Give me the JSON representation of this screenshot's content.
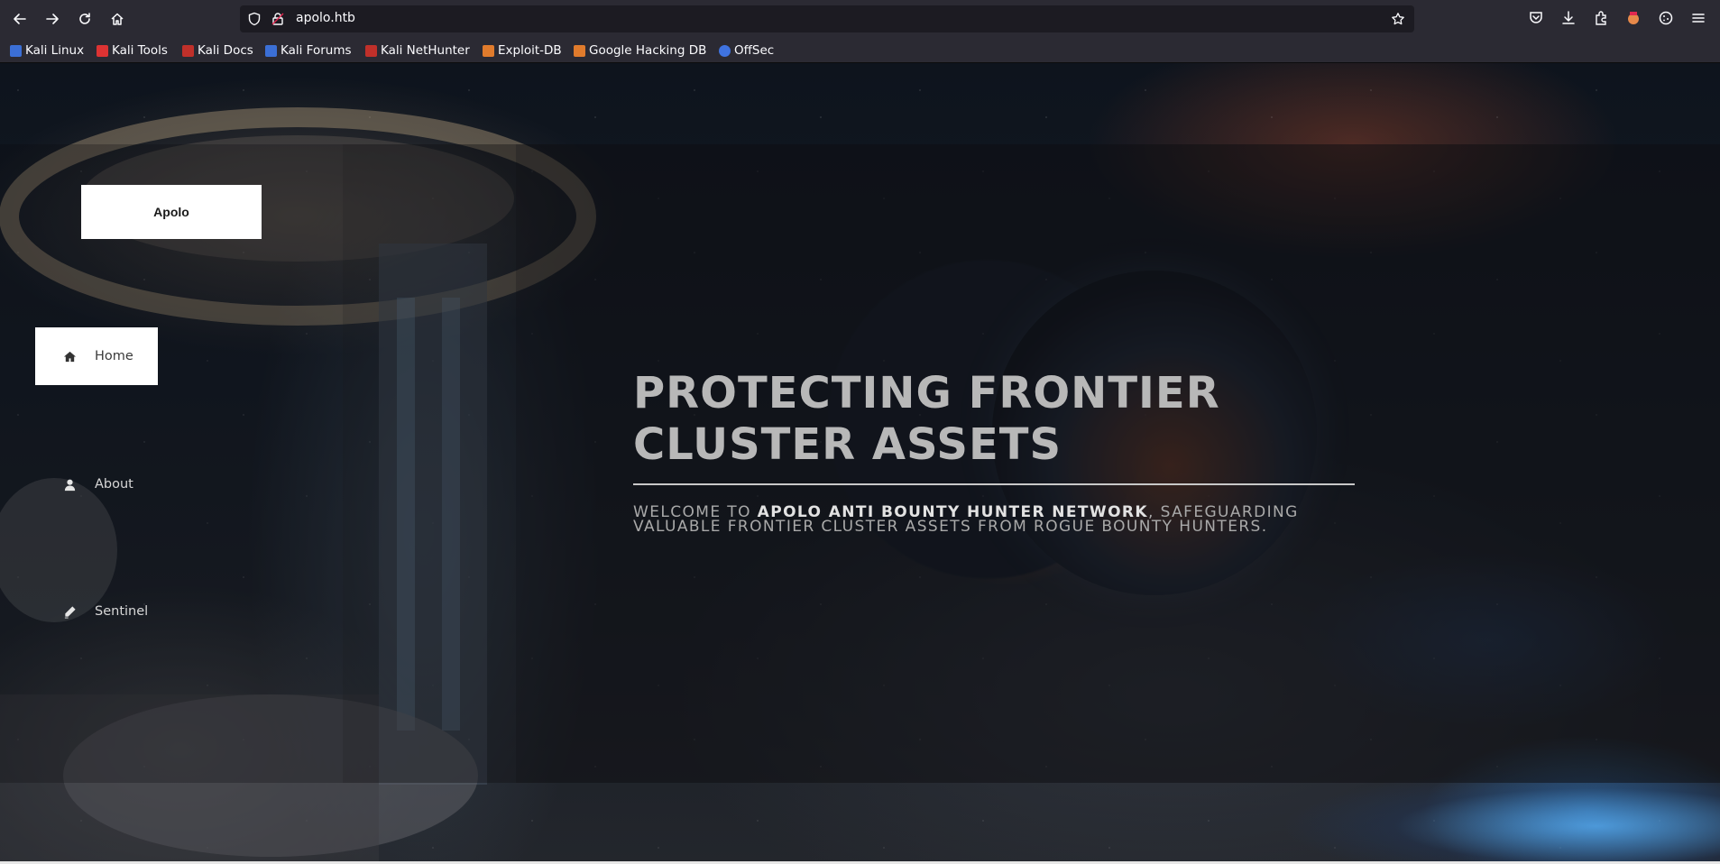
{
  "browser": {
    "url": "apolo.htb",
    "bookmarks": [
      {
        "label": "Kali Linux",
        "color": "#3b6fd6"
      },
      {
        "label": "Kali Tools",
        "color": "#d33"
      },
      {
        "label": "Kali Docs",
        "color": "#c0302a"
      },
      {
        "label": "Kali Forums",
        "color": "#3b6fd6"
      },
      {
        "label": "Kali NetHunter",
        "color": "#c0302a"
      },
      {
        "label": "Exploit-DB",
        "color": "#e07b2c"
      },
      {
        "label": "Google Hacking DB",
        "color": "#e07b2c"
      },
      {
        "label": "OffSec",
        "color": "#3f73e0"
      }
    ]
  },
  "site": {
    "logo": "Apolo",
    "menu": [
      {
        "label": "Home",
        "icon": "home-icon"
      },
      {
        "label": "About",
        "icon": "user-icon"
      },
      {
        "label": "Sentinel",
        "icon": "pencil-icon"
      }
    ],
    "hero": {
      "title": "PROTECTING FRONTIER CLUSTER ASSETS",
      "sub_prefix": "WELCOME TO ",
      "sub_strong": "APOLO ANTI BOUNTY HUNTER NETWORK",
      "sub_suffix": ", SAFEGUARDING VALUABLE FRONTIER CLUSTER ASSETS FROM ROGUE BOUNTY HUNTERS."
    }
  }
}
